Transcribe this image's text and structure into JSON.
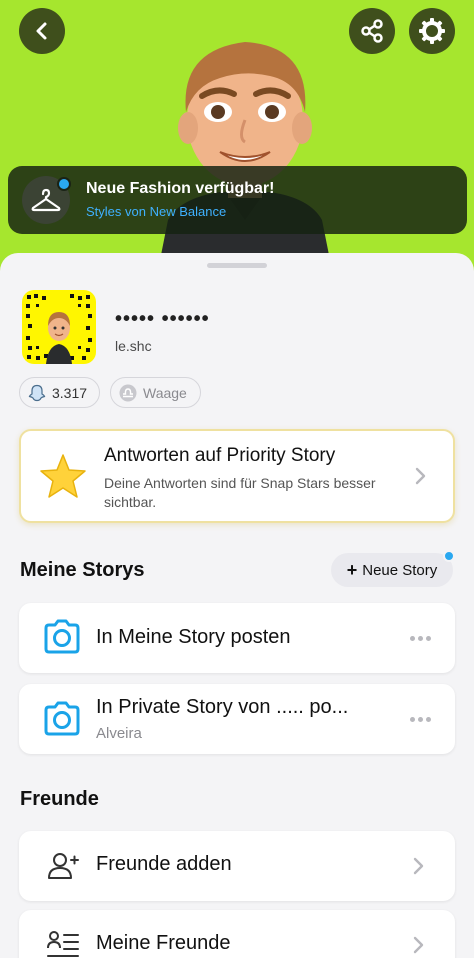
{
  "header": {
    "back_icon": "chevron-left-icon",
    "share_icon": "share-icon",
    "settings_icon": "gear-icon",
    "background_color": "#a6e62e"
  },
  "fashion_banner": {
    "title": "Neue Fashion verfügbar!",
    "subtitle": "Styles von New Balance",
    "icon": "hanger-icon",
    "accent_color": "#3fb1ff"
  },
  "profile": {
    "display_name": "••••• ••••••",
    "username": "le.shc",
    "snap_score": "3.317",
    "zodiac": "Waage"
  },
  "priority_story": {
    "title": "Antworten auf Priority Story",
    "description": "Deine Antworten sind für Snap Stars besser sichtbar."
  },
  "stories": {
    "section_title": "Meine Storys",
    "new_story_label": "Neue Story",
    "items": [
      {
        "label": "In Meine Story posten",
        "sublabel": ""
      },
      {
        "label": "In Private Story von ..... po...",
        "sublabel": "Alveira"
      }
    ]
  },
  "friends": {
    "section_title": "Freunde",
    "items": [
      {
        "label": "Freunde adden"
      },
      {
        "label": "Meine Freunde"
      }
    ]
  }
}
